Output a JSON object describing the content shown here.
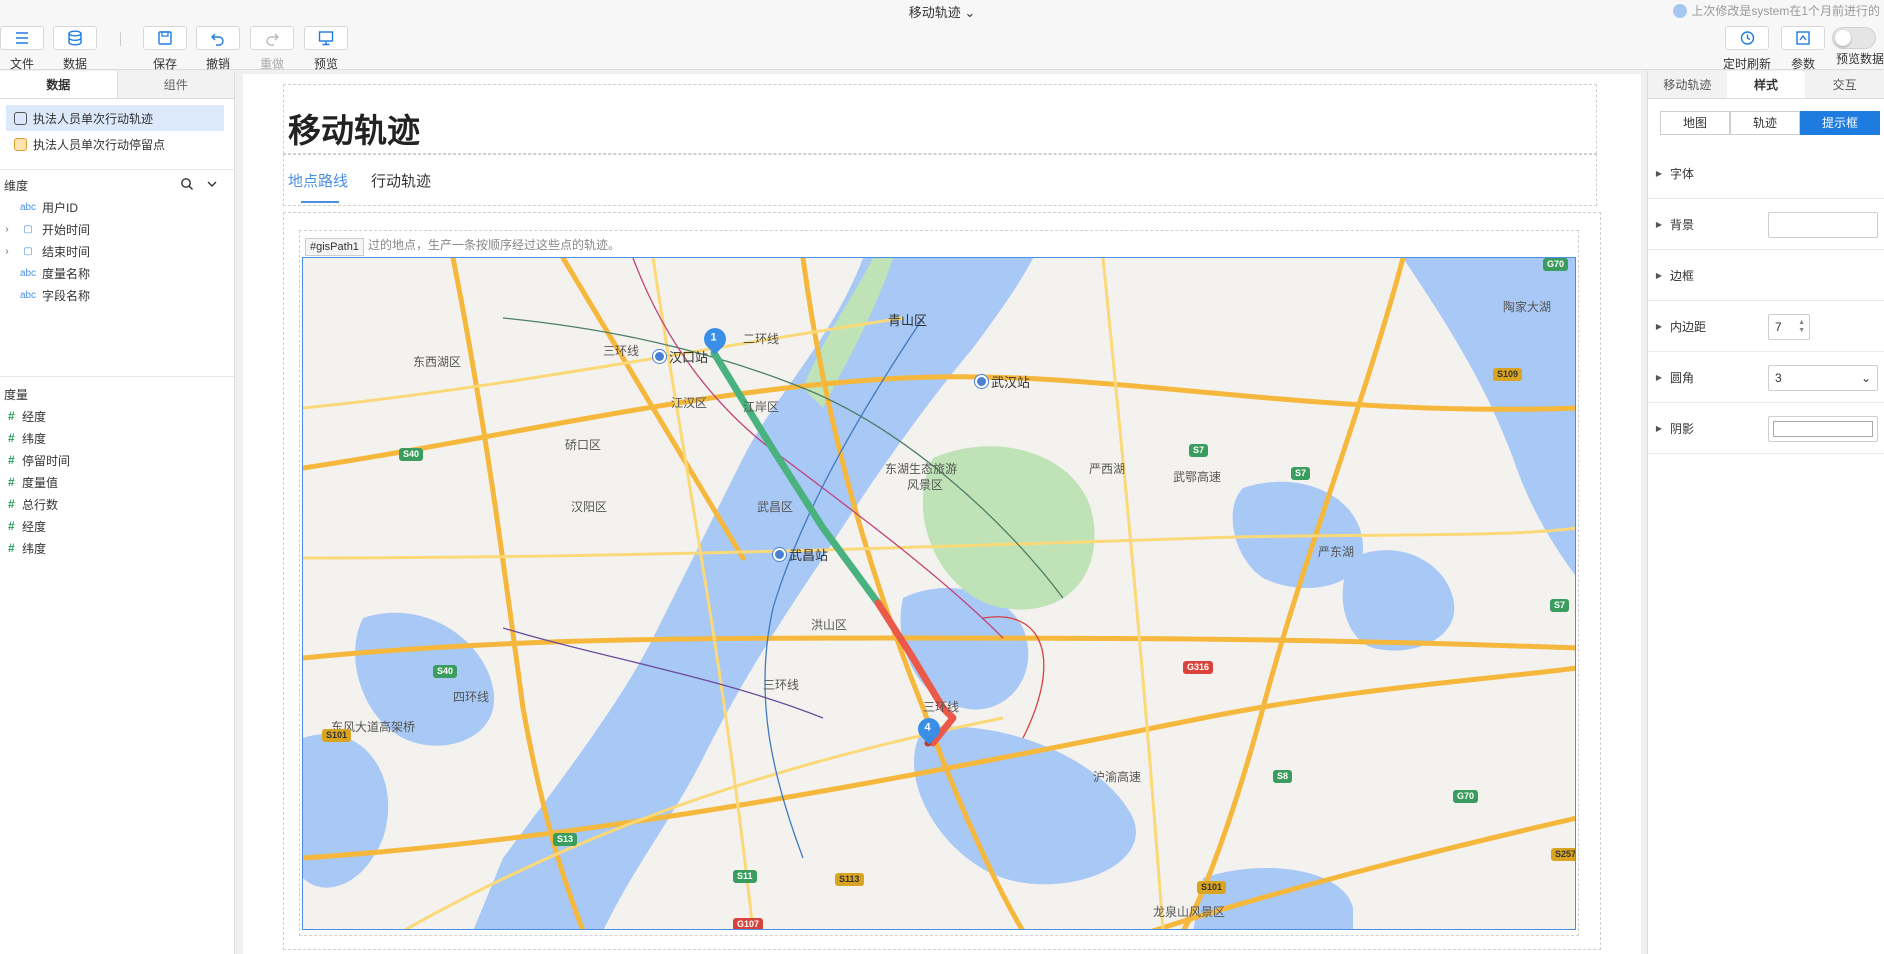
{
  "header": {
    "title": "移动轨迹",
    "last_modified": "上次修改是system在1个月前进行的",
    "buttons": {
      "file": "文件",
      "data": "数据",
      "save": "保存",
      "undo": "撤销",
      "redo": "重做",
      "preview": "预览",
      "refresh": "定时刷新",
      "params": "参数",
      "preview_data": "预览数据"
    }
  },
  "left": {
    "tabs": [
      "数据",
      "组件"
    ],
    "datasets": [
      "执法人员单次行动轨迹",
      "执法人员单次行动停留点"
    ],
    "dimensions_label": "维度",
    "dimensions": [
      {
        "type": "abc",
        "name": "用户ID"
      },
      {
        "type": "▢",
        "name": "开始时间"
      },
      {
        "type": "▢",
        "name": "结束时间"
      },
      {
        "type": "abc",
        "name": "度量名称"
      },
      {
        "type": "abc",
        "name": "字段名称"
      }
    ],
    "measures_label": "度量",
    "measures": [
      "经度",
      "纬度",
      "停留时间",
      "度量值",
      "总行数",
      "经度",
      "纬度"
    ],
    "measure_icon": "#"
  },
  "canvas": {
    "title": "移动轨迹",
    "tabs": [
      "地点路线",
      "行动轨迹"
    ],
    "description": "过的地点，生产一条按顺序经过这些点的轨迹。",
    "component_tag": "#gisPath1",
    "map": {
      "districts": [
        "青山区",
        "东西湖区",
        "江汉区",
        "江岸区",
        "硚口区",
        "汉阳区",
        "武昌区",
        "洪山区",
        "东湖生态旅游",
        "风景区",
        "严西湖",
        "严东湖",
        "陶家大湖",
        "龙泉山风景区"
      ],
      "stations": [
        "汉口站",
        "武汉站",
        "武昌站"
      ],
      "roads": [
        "三环线",
        "二环线",
        "四环线",
        "东风大道高架桥",
        "沪渝高速",
        "武鄂高速",
        "二环线"
      ],
      "shields": [
        "G70",
        "S109",
        "S7",
        "S7",
        "S7",
        "S40",
        "S40",
        "S101",
        "G316",
        "S8",
        "G70",
        "S13",
        "S11",
        "S113",
        "S101",
        "S257",
        "G107"
      ],
      "markers": [
        "1",
        "4"
      ]
    }
  },
  "right": {
    "tabs": [
      "移动轨迹",
      "样式",
      "交互"
    ],
    "segments": [
      "地图",
      "轨迹",
      "提示框"
    ],
    "props": {
      "font": "字体",
      "background": "背景",
      "border": "边框",
      "padding": "内边距",
      "padding_value": "7",
      "radius": "圆角",
      "radius_value": "3",
      "shadow": "阴影"
    }
  }
}
